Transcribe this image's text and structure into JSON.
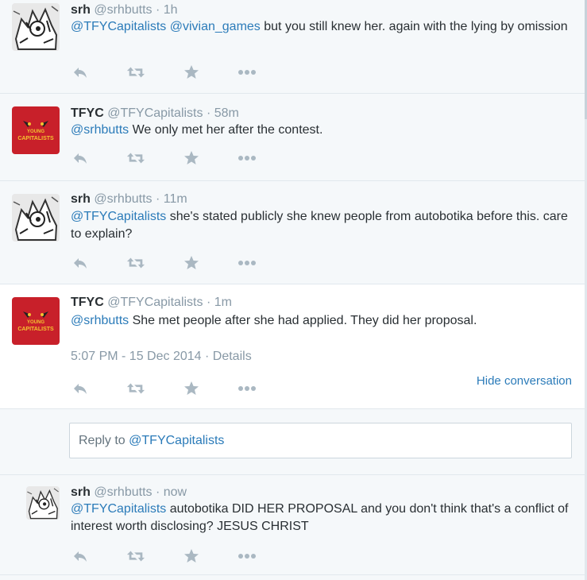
{
  "tweets": [
    {
      "name": "srh",
      "handle": "@srhbutts",
      "dot": "·",
      "time": "1h",
      "mentions": [
        "@TFYCapitalists",
        "@vivian_games"
      ],
      "text": "but you still knew her. again with the lying by omission",
      "avatar": "sketch-avatar"
    },
    {
      "name": "TFYC",
      "handle": "@TFYCapitalists",
      "dot": "·",
      "time": "58m",
      "mentions": [
        "@srhbutts"
      ],
      "text": "We only met her after the contest.",
      "avatar": "tfyc-logo-avatar"
    },
    {
      "name": "srh",
      "handle": "@srhbutts",
      "dot": "·",
      "time": "11m",
      "mentions": [
        "@TFYCapitalists"
      ],
      "text": "she's stated publicly she knew people from autobotika before this. care to explain?",
      "avatar": "sketch-avatar"
    },
    {
      "name": "TFYC",
      "handle": "@TFYCapitalists",
      "dot": "·",
      "time": "1m",
      "mentions": [
        "@srhbutts"
      ],
      "text": "She met people after she had applied. They did her proposal.",
      "timestamp": "5:07 PM - 15 Dec 2014",
      "details_sep": "·",
      "details": "Details",
      "hide_conversation": "Hide conversation",
      "avatar": "tfyc-logo-avatar"
    },
    {
      "name": "srh",
      "handle": "@srhbutts",
      "dot": "·",
      "time": "now",
      "mentions": [
        "@TFYCapitalists"
      ],
      "text": "autobotika DID HER PROPOSAL and you don't think that's a conflict of interest worth disclosing? JESUS CHRIST",
      "avatar": "sketch-avatar"
    }
  ],
  "reply": {
    "prefix": "Reply to",
    "mention": "@TFYCapitalists"
  },
  "logo": {
    "line1": "YOUNG",
    "line2": "CAPITALISTS"
  },
  "icons": {
    "reply": "reply-icon",
    "retweet": "retweet-icon",
    "favorite": "star-icon",
    "more": "more-icon"
  },
  "colors": {
    "link": "#2b7bb9",
    "muted": "#8899a6",
    "icon": "#aab8c2",
    "tfyc_red": "#c8202a"
  }
}
